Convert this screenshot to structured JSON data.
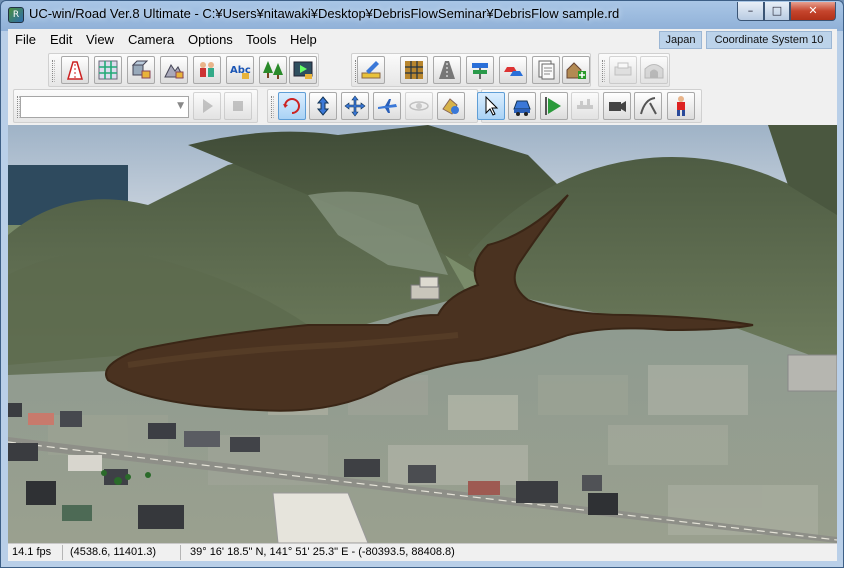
{
  "window": {
    "title": "UC-win/Road Ver.8 Ultimate - C:¥Users¥nitawaki¥Desktop¥DebrisFlowSeminar¥DebrisFlow sample.rd",
    "minimize_icon": "minimize-icon",
    "maximize_icon": "maximize-icon",
    "close_icon": "close-icon"
  },
  "menu": {
    "items": [
      "File",
      "Edit",
      "View",
      "Camera",
      "Options",
      "Tools",
      "Help"
    ],
    "region_tag": "Japan",
    "coordinate_tag": "Coordinate System 10"
  },
  "toolbar": {
    "row1_group1": [
      "road-edit-icon",
      "intersection-icon",
      "model-3d-icon",
      "terrain-icon",
      "people-icon",
      "text-abc-icon",
      "trees-icon",
      "scenario-icon"
    ],
    "row1_group2": [
      "ruler-edit-icon",
      "grid-map-icon",
      "road-icon",
      "signpost-icon",
      "cars-icon",
      "documents-icon",
      "house-add-icon"
    ],
    "row1_group3": [
      "print-icon",
      "tunnel-icon"
    ],
    "row2_playback": [
      "play-icon",
      "stop-icon"
    ],
    "row2_navigation": [
      "rotate-icon",
      "up-down-icon",
      "pan-icon",
      "fly-icon",
      "orbit-icon",
      "debris-icon"
    ],
    "row2_tools": [
      "pointer-icon",
      "vehicle-view-icon",
      "flag-icon",
      "crane-icon",
      "camera-icon",
      "transit-icon",
      "pedestrian-icon"
    ],
    "scenario_select_value": ""
  },
  "status": {
    "fps": "14.1 fps",
    "position": "(4538.6, 11401.3)",
    "geo": "39°  16' 18.5\" N, 141°  51' 25.3\" E  - (-80393.5, 88408.8)"
  }
}
